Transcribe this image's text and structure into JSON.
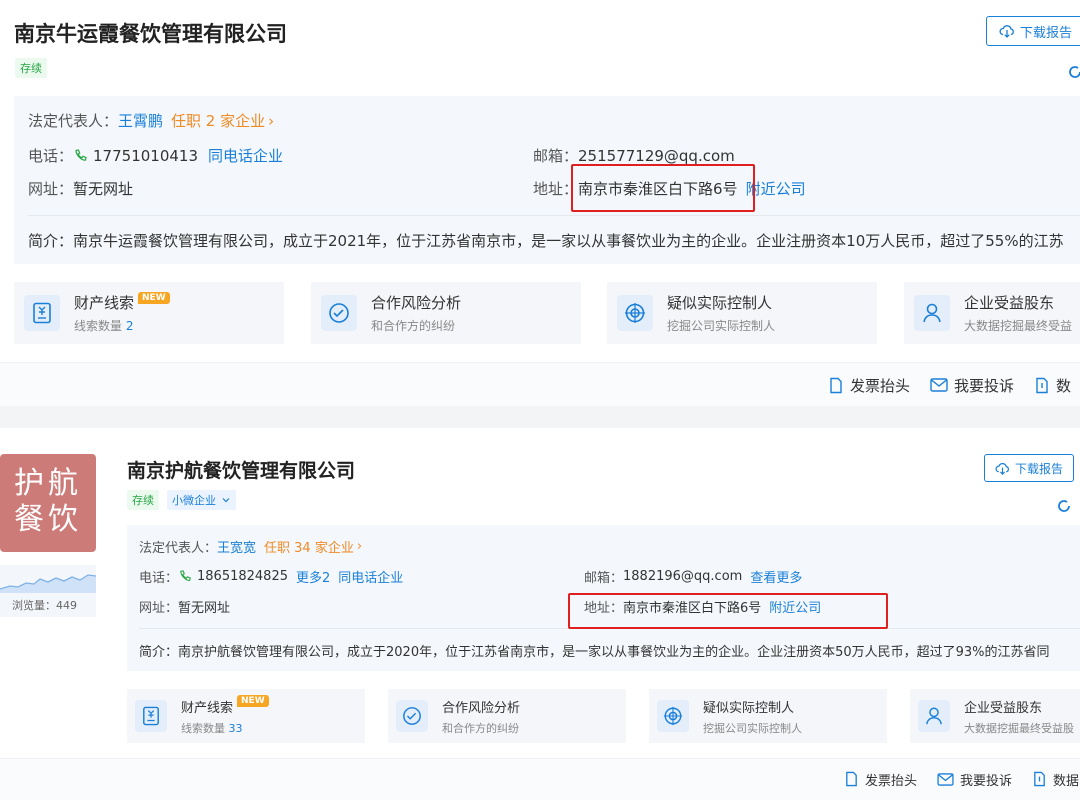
{
  "company1": {
    "name": "南京牛运霞餐饮管理有限公司",
    "status": "存续",
    "download_label": "下载报告",
    "legal_rep_label": "法定代表人：",
    "legal_rep_name": "王霄鹏",
    "positions": "任职 2 家企业",
    "phone_label": "电话：",
    "phone": "17751010413",
    "same_phone": "同电话企业",
    "email_label": "邮箱：",
    "email": "251577129@qq.com",
    "website_label": "网址：",
    "website": "暂无网址",
    "address_label": "地址：",
    "address": "南京市秦淮区白下路6号",
    "nearby": "附近公司",
    "intro": "简介：南京牛运霞餐饮管理有限公司，成立于2021年，位于江苏省南京市，是一家以从事餐饮业为主的企业。企业注册资本10万人民币，超过了55%的江苏",
    "tiles": [
      {
        "title": "财产线索",
        "new": "NEW",
        "sub_label": "线索数量 ",
        "sub_value": "2"
      },
      {
        "title": "合作风险分析",
        "sub_label": "和合作方的纠纷"
      },
      {
        "title": "疑似实际控制人",
        "sub_label": "挖掘公司实际控制人"
      },
      {
        "title": "企业受益股东",
        "sub_label": "大数据挖掘最终受益"
      }
    ],
    "actions": [
      "发票抬头",
      "我要投诉",
      "数"
    ]
  },
  "company2": {
    "logo_text_1": "护航",
    "logo_text_2": "餐饮",
    "views_label": "浏览量：449",
    "name": "南京护航餐饮管理有限公司",
    "status": "存续",
    "scale": "小微企业",
    "download_label": "下载报告",
    "legal_rep_label": "法定代表人：",
    "legal_rep_name": "王宽宽",
    "positions": "任职 34 家企业",
    "phone_label": "电话：",
    "phone": "18651824825",
    "more_phone": "更多2",
    "same_phone": "同电话企业",
    "email_label": "邮箱：",
    "email": "1882196@qq.com",
    "see_more": "查看更多",
    "website_label": "网址：",
    "website": "暂无网址",
    "address_label": "地址：",
    "address": "南京市秦淮区白下路6号",
    "nearby": "附近公司",
    "intro": "简介：南京护航餐饮管理有限公司，成立于2020年，位于江苏省南京市，是一家以从事餐饮业为主的企业。企业注册资本50万人民币，超过了93%的江苏省同",
    "tiles": [
      {
        "title": "财产线索",
        "new": "NEW",
        "sub_label": "线索数量 ",
        "sub_value": "33"
      },
      {
        "title": "合作风险分析",
        "sub_label": "和合作方的纠纷"
      },
      {
        "title": "疑似实际控制人",
        "sub_label": "挖掘公司实际控制人"
      },
      {
        "title": "企业受益股东",
        "sub_label": "大数据挖掘最终受益股"
      }
    ],
    "actions": [
      "发票抬头",
      "我要投诉",
      "数据"
    ]
  },
  "colors": {
    "accent": "#1a7fd8",
    "orange": "#f08a24",
    "highlight": "#e02020",
    "logo_bg": "#cd7b78"
  }
}
